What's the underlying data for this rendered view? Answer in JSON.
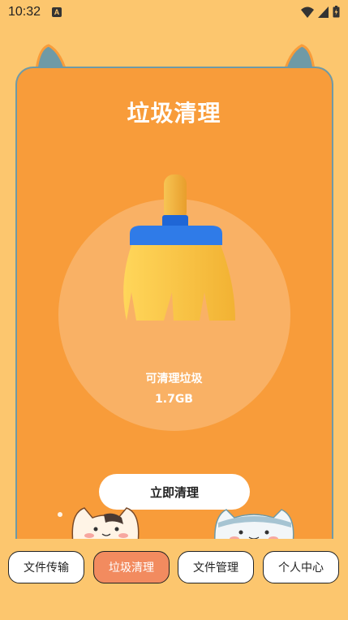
{
  "status_bar": {
    "time": "10:32",
    "notification_letter": "A"
  },
  "page": {
    "title": "垃圾清理",
    "junk_label": "可清理垃圾",
    "junk_size": "1.7GB",
    "clean_button": "立即清理"
  },
  "bottom_nav": {
    "items": [
      {
        "label": "文件传输",
        "active": false
      },
      {
        "label": "垃圾清理",
        "active": true
      },
      {
        "label": "文件管理",
        "active": false
      },
      {
        "label": "个人中心",
        "active": false
      }
    ]
  },
  "colors": {
    "background": "#FCC66E",
    "card": "#F89C3A",
    "active_tab": "#F28B5F",
    "broom_handle": "#F4B544",
    "broom_band": "#1F66D6"
  }
}
